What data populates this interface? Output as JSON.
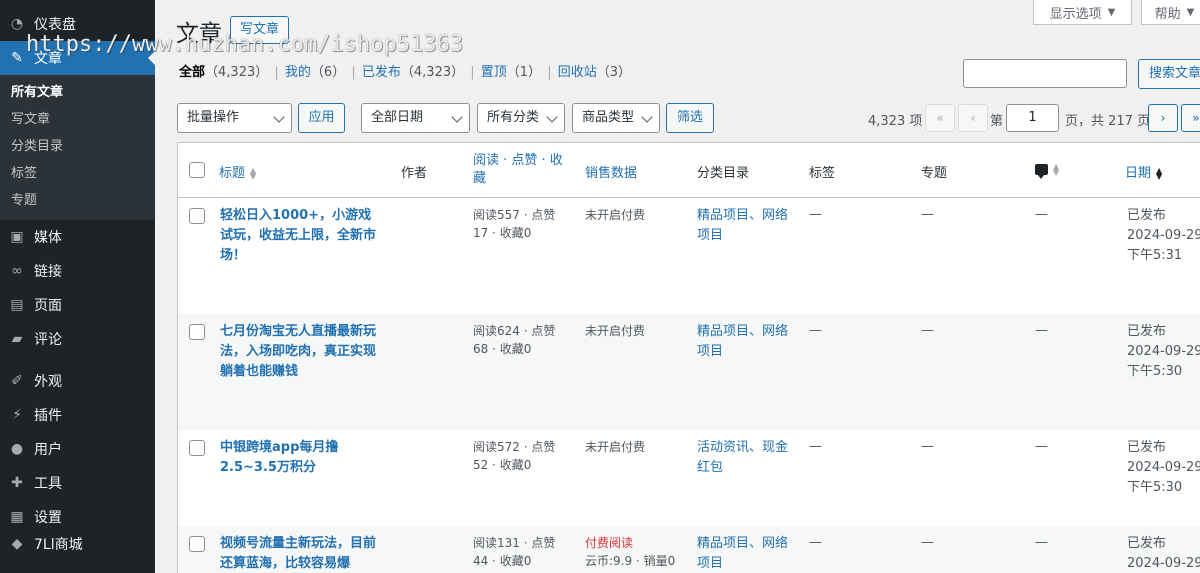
{
  "watermark": "https://www.huzhan.com/ishop51363",
  "sidebar": {
    "dashboard": "仪表盘",
    "posts": "文章",
    "submenu": [
      "所有文章",
      "写文章",
      "分类目录",
      "标签",
      "专题"
    ],
    "media": "媒体",
    "links": "链接",
    "pages": "页面",
    "comments": "评论",
    "appearance": "外观",
    "plugins": "插件",
    "users": "用户",
    "tools": "工具",
    "settings": "设置",
    "cut_item": "7Ll商城"
  },
  "screen_options": {
    "label": "显示选项",
    "help": "帮助"
  },
  "header": {
    "title": "文章",
    "add_new": "写文章"
  },
  "filters": {
    "all": "全部",
    "all_count": "（4,323）",
    "mine": "我的",
    "mine_count": "（6）",
    "published": "已发布",
    "published_count": "（4,323）",
    "sticky": "置顶",
    "sticky_count": "（1）",
    "trash": "回收站",
    "trash_count": "（3）",
    "sep": "|"
  },
  "search": {
    "button": "搜索文章",
    "value": ""
  },
  "toolbar": {
    "bulk": "批量操作",
    "apply": "应用",
    "dates": "全部日期",
    "categories": "所有分类",
    "product_type": "商品类型",
    "filter": "筛选"
  },
  "pagination": {
    "items": "4,323 项",
    "first": "«",
    "prev": "‹",
    "next": "›",
    "last": "»",
    "page_label": "第",
    "current": "1",
    "total": "页，共 217 页"
  },
  "columns": {
    "title": "标题",
    "author": "作者",
    "reads": "阅读 · 点赞 · 收藏",
    "sales": "销售数据",
    "category": "分类目录",
    "tags": "标签",
    "topic": "专题",
    "date": "日期"
  },
  "rows": [
    {
      "title": "轻松日入1000+，小游戏试玩，收益无上限，全新市场！",
      "reads": "阅读557 · 点赞17 · 收藏0",
      "sales": "未开启付费",
      "sales2": "",
      "category": "精品项目、网络项目",
      "tags": "—",
      "topic": "—",
      "comments": "—",
      "status": "已发布",
      "date": "2024-09-29",
      "time": "下午5:31"
    },
    {
      "title": "七月份淘宝无人直播最新玩法，入场即吃肉，真正实现躺着也能赚钱",
      "reads": "阅读624 · 点赞68 · 收藏0",
      "sales": "未开启付费",
      "sales2": "",
      "category": "精品项目、网络项目",
      "tags": "—",
      "topic": "—",
      "comments": "—",
      "status": "已发布",
      "date": "2024-09-29",
      "time": "下午5:30"
    },
    {
      "title": "中银跨境app每月撸2.5~3.5万积分",
      "reads": "阅读572 · 点赞52 · 收藏0",
      "sales": "未开启付费",
      "sales2": "",
      "category": "活动资讯、现金红包",
      "tags": "—",
      "topic": "—",
      "comments": "—",
      "status": "已发布",
      "date": "2024-09-29",
      "time": "下午5:30"
    },
    {
      "title": "视频号流量主新玩法，目前还算蓝海，比较容易爆",
      "reads": "阅读131 · 点赞44 · 收藏0",
      "sales": "付费阅读",
      "sales2": "云币:9.9 · 销量0",
      "category": "精品项目、网络项目",
      "tags": "—",
      "topic": "—",
      "comments": "—",
      "status": "已发布",
      "date": "2024-09-29",
      "time": ""
    }
  ]
}
